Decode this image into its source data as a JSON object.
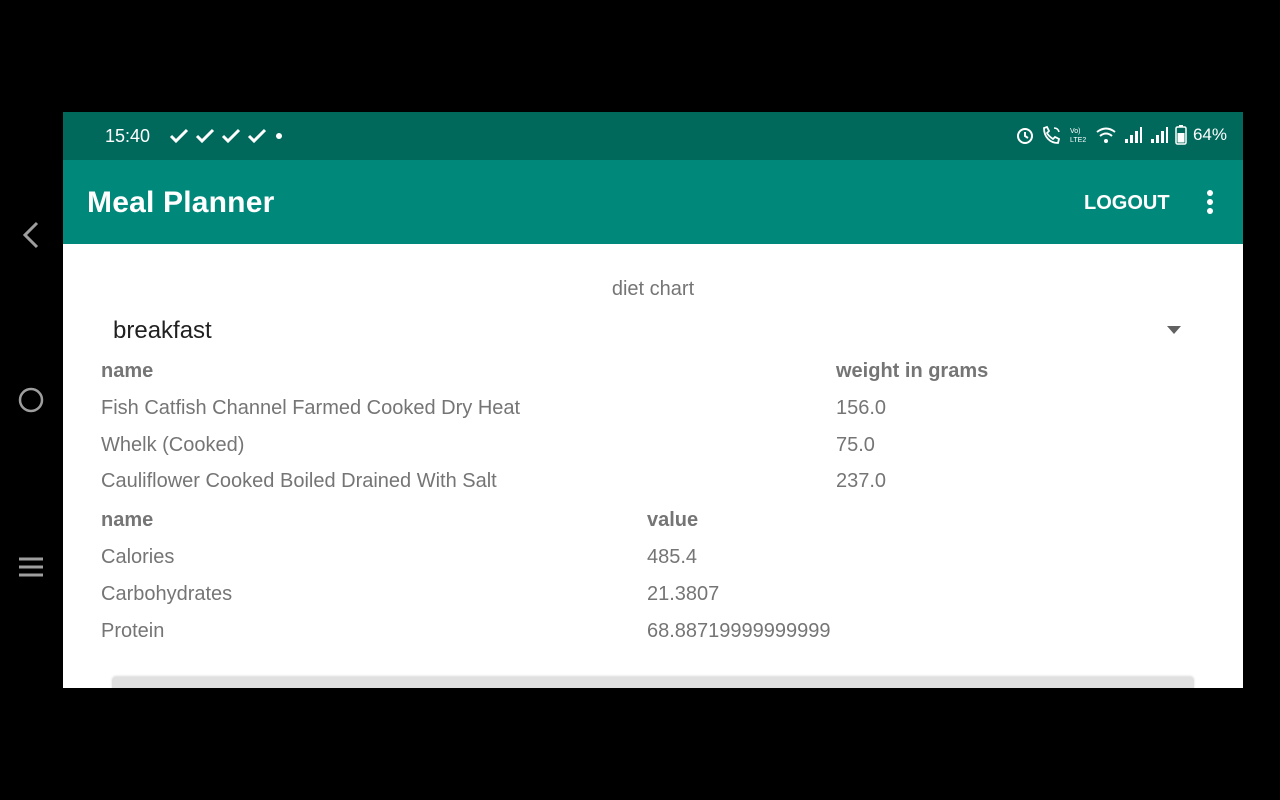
{
  "status_bar": {
    "time": "15:40",
    "battery": "64%",
    "left_icons": [
      "check-icon",
      "check-icon",
      "check-icon",
      "check-icon",
      "dot-icon"
    ],
    "right_icons": [
      "alarm-icon",
      "wifi-call-icon",
      "volte-icon",
      "wifi-icon",
      "signal-icon",
      "signal-icon",
      "battery-icon"
    ]
  },
  "app_bar": {
    "title": "Meal Planner",
    "logout_label": "LOGOUT"
  },
  "main": {
    "section_title": "diet chart",
    "meal_spinner": {
      "selected": "breakfast"
    },
    "food_table": {
      "headers": {
        "name": "name",
        "weight": "weight in grams"
      },
      "rows": [
        {
          "name": "Fish Catfish Channel Farmed Cooked Dry Heat",
          "weight": "156.0"
        },
        {
          "name": "Whelk (Cooked)",
          "weight": "75.0"
        },
        {
          "name": "Cauliflower Cooked Boiled Drained With Salt",
          "weight": "237.0"
        }
      ]
    },
    "nutrition_table": {
      "headers": {
        "name": "name",
        "value": "value"
      },
      "rows": [
        {
          "name": "Calories",
          "value": "485.4"
        },
        {
          "name": "Carbohydrates",
          "value": "21.3807"
        },
        {
          "name": "Protein",
          "value": "68.88719999999999"
        }
      ]
    }
  },
  "colors": {
    "status_bar": "#00695c",
    "app_bar": "#00897b",
    "text_secondary": "#757575"
  }
}
